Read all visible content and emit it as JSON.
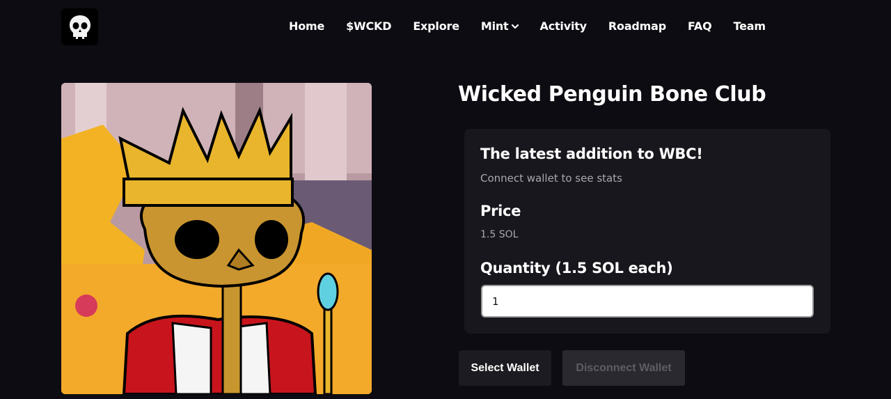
{
  "nav": {
    "logo_alt": "skull-logo",
    "items": [
      {
        "label": "Home"
      },
      {
        "label": "$WCKD"
      },
      {
        "label": "Explore"
      },
      {
        "label": "Mint"
      },
      {
        "label": "Activity"
      },
      {
        "label": "Roadmap"
      },
      {
        "label": "FAQ"
      },
      {
        "label": "Team"
      }
    ]
  },
  "main": {
    "title": "Wicked Penguin Bone Club",
    "card": {
      "heading": "The latest addition to WBC!",
      "subheading": "Connect wallet to see stats",
      "price_label": "Price",
      "price_value": "1.5 SOL",
      "quantity_label": "Quantity (1.5 SOL each)",
      "quantity_value": "1"
    },
    "buttons": {
      "select_wallet": "Select Wallet",
      "disconnect_wallet": "Disconnect Wallet"
    }
  },
  "colors": {
    "background": "#0d0c12",
    "card": "#18171d",
    "crown_gold": "#e8b52c",
    "robe_red": "#c8141c"
  },
  "icons": [
    "skull-icon",
    "chevron-down-icon"
  ]
}
